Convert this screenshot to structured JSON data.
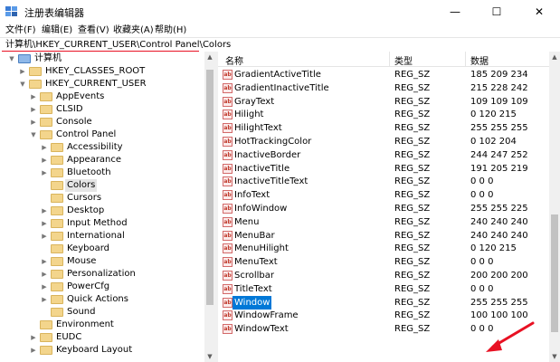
{
  "window": {
    "title": "注册表编辑器",
    "minimize": "—",
    "maximize": "☐",
    "close": "✕"
  },
  "menu": [
    "文件(F)",
    "编辑(E)",
    "查看(V)",
    "收藏夹(A)",
    "帮助(H)"
  ],
  "address": "计算机\\HKEY_CURRENT_USER\\Control Panel\\Colors",
  "accent": "#e81123",
  "selection_color": "#0078d7",
  "tree": [
    {
      "label": "计算机",
      "level": 0,
      "expanded": true
    },
    {
      "label": "HKEY_CLASSES_ROOT",
      "level": 1,
      "expanded": false
    },
    {
      "label": "HKEY_CURRENT_USER",
      "level": 1,
      "expanded": true
    },
    {
      "label": "AppEvents",
      "level": 2,
      "expanded": false
    },
    {
      "label": "CLSID",
      "level": 2,
      "expanded": false
    },
    {
      "label": "Console",
      "level": 2,
      "expanded": false
    },
    {
      "label": "Control Panel",
      "level": 2,
      "expanded": true
    },
    {
      "label": "Accessibility",
      "level": 3,
      "expanded": false
    },
    {
      "label": "Appearance",
      "level": 3,
      "expanded": false
    },
    {
      "label": "Bluetooth",
      "level": 3,
      "expanded": false
    },
    {
      "label": "Colors",
      "level": 3,
      "expanded": null,
      "selected": true
    },
    {
      "label": "Cursors",
      "level": 3,
      "expanded": null
    },
    {
      "label": "Desktop",
      "level": 3,
      "expanded": false
    },
    {
      "label": "Input Method",
      "level": 3,
      "expanded": false
    },
    {
      "label": "International",
      "level": 3,
      "expanded": false
    },
    {
      "label": "Keyboard",
      "level": 3,
      "expanded": null
    },
    {
      "label": "Mouse",
      "level": 3,
      "expanded": false
    },
    {
      "label": "Personalization",
      "level": 3,
      "expanded": false
    },
    {
      "label": "PowerCfg",
      "level": 3,
      "expanded": false
    },
    {
      "label": "Quick Actions",
      "level": 3,
      "expanded": false
    },
    {
      "label": "Sound",
      "level": 3,
      "expanded": null
    },
    {
      "label": "Environment",
      "level": 2,
      "expanded": null
    },
    {
      "label": "EUDC",
      "level": 2,
      "expanded": false
    },
    {
      "label": "Keyboard Layout",
      "level": 2,
      "expanded": false
    }
  ],
  "columns": {
    "name": "名称",
    "type": "类型",
    "data": "数据"
  },
  "values": [
    {
      "name": "GradientActiveTitle",
      "type": "REG_SZ",
      "data": "185 209 234"
    },
    {
      "name": "GradientInactiveTitle",
      "type": "REG_SZ",
      "data": "215 228 242"
    },
    {
      "name": "GrayText",
      "type": "REG_SZ",
      "data": "109 109 109"
    },
    {
      "name": "Hilight",
      "type": "REG_SZ",
      "data": "0 120 215"
    },
    {
      "name": "HilightText",
      "type": "REG_SZ",
      "data": "255 255 255"
    },
    {
      "name": "HotTrackingColor",
      "type": "REG_SZ",
      "data": "0 102 204"
    },
    {
      "name": "InactiveBorder",
      "type": "REG_SZ",
      "data": "244 247 252"
    },
    {
      "name": "InactiveTitle",
      "type": "REG_SZ",
      "data": "191 205 219"
    },
    {
      "name": "InactiveTitleText",
      "type": "REG_SZ",
      "data": "0 0 0"
    },
    {
      "name": "InfoText",
      "type": "REG_SZ",
      "data": "0 0 0"
    },
    {
      "name": "InfoWindow",
      "type": "REG_SZ",
      "data": "255 255 225"
    },
    {
      "name": "Menu",
      "type": "REG_SZ",
      "data": "240 240 240"
    },
    {
      "name": "MenuBar",
      "type": "REG_SZ",
      "data": "240 240 240"
    },
    {
      "name": "MenuHilight",
      "type": "REG_SZ",
      "data": "0 120 215"
    },
    {
      "name": "MenuText",
      "type": "REG_SZ",
      "data": "0 0 0"
    },
    {
      "name": "Scrollbar",
      "type": "REG_SZ",
      "data": "200 200 200"
    },
    {
      "name": "TitleText",
      "type": "REG_SZ",
      "data": "0 0 0"
    },
    {
      "name": "Window",
      "type": "REG_SZ",
      "data": "255 255 255",
      "selected": true
    },
    {
      "name": "WindowFrame",
      "type": "REG_SZ",
      "data": "100 100 100"
    },
    {
      "name": "WindowText",
      "type": "REG_SZ",
      "data": "0 0 0"
    }
  ]
}
